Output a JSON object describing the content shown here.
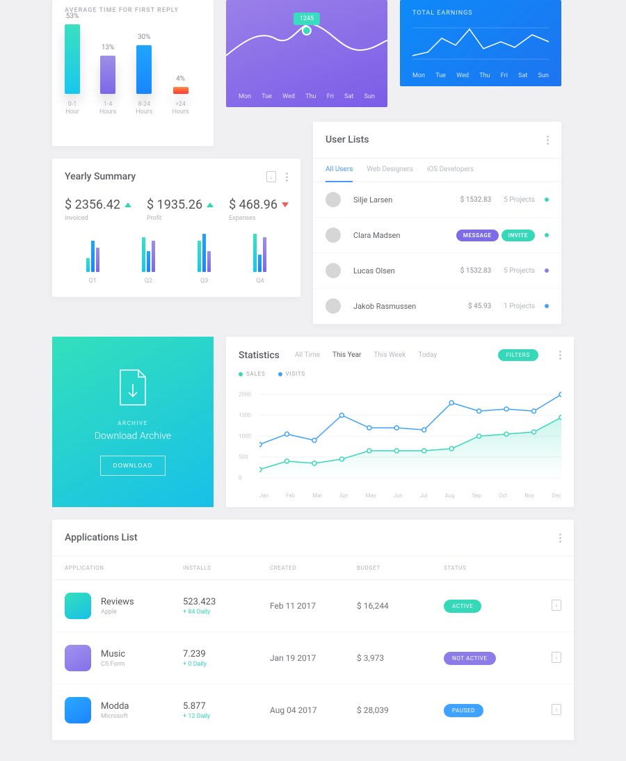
{
  "reply_card": {
    "title": "AVERAGE TIME FOR FIRST REPLY",
    "bars": [
      {
        "pct": "53%",
        "h": 100,
        "cls": "b-green",
        "label1": "0-1",
        "label2": "Hour"
      },
      {
        "pct": "13%",
        "h": 55,
        "cls": "b-purple",
        "label1": "1-4",
        "label2": "Hours"
      },
      {
        "pct": "30%",
        "h": 70,
        "cls": "b-blue",
        "label1": "8-24",
        "label2": "Hours"
      },
      {
        "pct": "4%",
        "h": 10,
        "cls": "b-orange",
        "label1": ">24",
        "label2": "Hours"
      }
    ]
  },
  "purple_card": {
    "tooltip": "1245",
    "days": [
      "Mon",
      "Tue",
      "Wed",
      "Thu",
      "Fri",
      "Sat",
      "Sun"
    ]
  },
  "blue_card": {
    "title": "TOTAL EARNINGS",
    "days": [
      "Mon",
      "Tue",
      "Wed",
      "Thu",
      "Fri",
      "Sat",
      "Sun"
    ]
  },
  "yearly_summary": {
    "title": "Yearly Summary",
    "metrics": [
      {
        "amount": "$ 2356.42",
        "trend": "up",
        "label": "Invoiced"
      },
      {
        "amount": "$ 1935.26",
        "trend": "up",
        "label": "Profit"
      },
      {
        "amount": "$ 468.96",
        "trend": "down",
        "label": "Expenses"
      }
    ],
    "quarters": [
      "Q1",
      "Q2",
      "Q3",
      "Q4"
    ]
  },
  "user_lists": {
    "title": "User Lists",
    "tabs": [
      "All Users",
      "Web Designers",
      "iOS Developers"
    ],
    "rows": [
      {
        "name": "Silje Larsen",
        "amount": "$ 1532.83",
        "projects": "5 Projects",
        "dot": "#35d9b9"
      },
      {
        "name": "Clara Madsen",
        "msg": "MESSAGE",
        "inv": "INVITE",
        "dot": "#35d9b9"
      },
      {
        "name": "Lucas Olsen",
        "amount": "$ 1532.83",
        "projects": "5 Projects",
        "dot": "#8c7ce8"
      },
      {
        "name": "Jakob Rasmussen",
        "amount": "$ 45.93",
        "projects": "1 Projects",
        "dot": "#3fa2ff"
      }
    ]
  },
  "archive": {
    "sub": "ARCHIVE",
    "title": "Download Archive",
    "btn": "DOWNLOAD"
  },
  "stats": {
    "title": "Statistics",
    "tabs": [
      "All Time",
      "This Year",
      "This Week",
      "Today"
    ],
    "active_tab": 1,
    "filter": "FILTERS",
    "legend": [
      {
        "label": "SALES",
        "color": "#35d9b9"
      },
      {
        "label": "VISITS",
        "color": "#3fa2ff"
      }
    ],
    "ylabels": [
      "2000",
      "1500",
      "1000",
      "500",
      "0"
    ],
    "xlabels": [
      "Jan",
      "Feb",
      "Mar",
      "Apr",
      "May",
      "Jun",
      "Jul",
      "Aug",
      "Sep",
      "Oct",
      "Nov",
      "Dec"
    ]
  },
  "apps": {
    "title": "Applications List",
    "cols": [
      "APPLICATION",
      "INSTALLS",
      "CREATED",
      "BUDGET",
      "STATUS"
    ],
    "rows": [
      {
        "name": "Reviews",
        "sub": "Apple",
        "installs": "523.423",
        "daily": "+ 84 Daily",
        "created": "Feb 11 2017",
        "budget": "$ 16,244",
        "status": "ACTIVE",
        "stCls": "st-green",
        "iconBg": "linear-gradient(150deg,#33e0bb,#18c0e8)"
      },
      {
        "name": "Music",
        "sub": "CS Form",
        "installs": "7.239",
        "daily": "+ 0 Daily",
        "created": "Jan 19 2017",
        "budget": "$ 3,973",
        "status": "NOT ACTIVE",
        "stCls": "st-purple",
        "iconBg": "linear-gradient(150deg,#a393ef,#8370ea)"
      },
      {
        "name": "Modda",
        "sub": "Microsoft",
        "installs": "5.877",
        "daily": "+ 12 Daily",
        "created": "Aug 04 2017",
        "budget": "$ 28,039",
        "status": "PAUSED",
        "stCls": "st-blue",
        "iconBg": "linear-gradient(150deg,#2aa9ff,#1c84ff)"
      }
    ]
  },
  "chart_data": [
    {
      "type": "bar",
      "title": "AVERAGE TIME FOR FIRST REPLY",
      "categories": [
        "0-1 Hour",
        "1-4 Hours",
        "8-24 Hours",
        ">24 Hours"
      ],
      "values": [
        53,
        13,
        30,
        4
      ],
      "ylabel": "%"
    },
    {
      "type": "line",
      "title": "Weekly (purple)",
      "categories": [
        "Mon",
        "Tue",
        "Wed",
        "Thu",
        "Fri",
        "Sat",
        "Sun"
      ],
      "values": [
        900,
        1100,
        800,
        1245,
        1050,
        950,
        1100
      ],
      "annotation": {
        "Thu": 1245
      }
    },
    {
      "type": "line",
      "title": "TOTAL EARNINGS",
      "categories": [
        "Mon",
        "Tue",
        "Wed",
        "Thu",
        "Fri",
        "Sat",
        "Sun"
      ],
      "values": [
        40,
        60,
        55,
        85,
        60,
        55,
        80
      ]
    },
    {
      "type": "bar",
      "title": "Yearly Summary quarters",
      "categories": [
        "Q1",
        "Q2",
        "Q3",
        "Q4"
      ],
      "series": [
        {
          "name": "green",
          "values": [
            20,
            50,
            45,
            55
          ]
        },
        {
          "name": "blue",
          "values": [
            45,
            30,
            55,
            25
          ]
        },
        {
          "name": "purple",
          "values": [
            35,
            45,
            30,
            50
          ]
        }
      ]
    },
    {
      "type": "line",
      "title": "Statistics",
      "xlabel": "",
      "ylabel": "",
      "ylim": [
        0,
        2000
      ],
      "categories": [
        "Jan",
        "Feb",
        "Mar",
        "Apr",
        "May",
        "Jun",
        "Jul",
        "Aug",
        "Sep",
        "Oct",
        "Nov",
        "Dec"
      ],
      "series": [
        {
          "name": "VISITS",
          "values": [
            800,
            1050,
            900,
            1500,
            1200,
            1200,
            1150,
            1800,
            1600,
            1650,
            1600,
            2000
          ]
        },
        {
          "name": "SALES",
          "values": [
            200,
            400,
            350,
            450,
            650,
            650,
            650,
            700,
            1000,
            1050,
            1100,
            1450
          ]
        }
      ]
    }
  ]
}
